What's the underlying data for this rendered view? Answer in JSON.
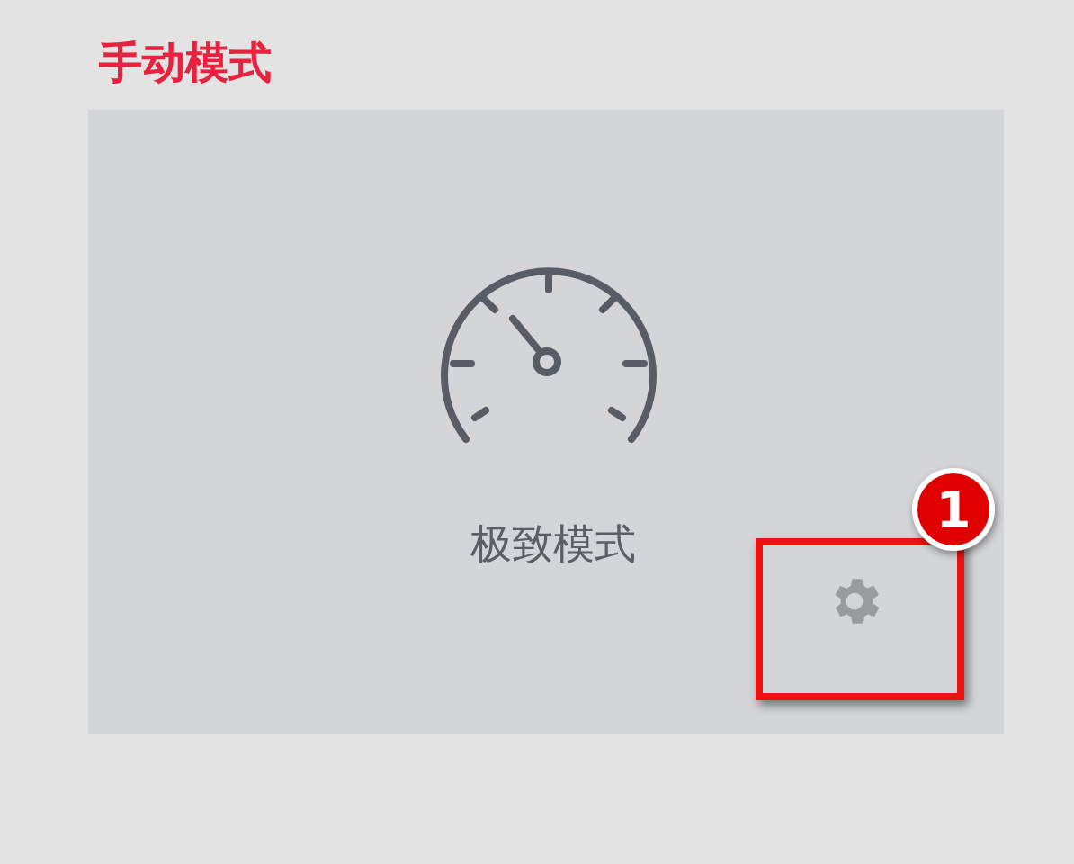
{
  "section_title": "手动模式",
  "mode_card": {
    "label": "极致模式"
  },
  "annotation": {
    "badge": "1"
  }
}
